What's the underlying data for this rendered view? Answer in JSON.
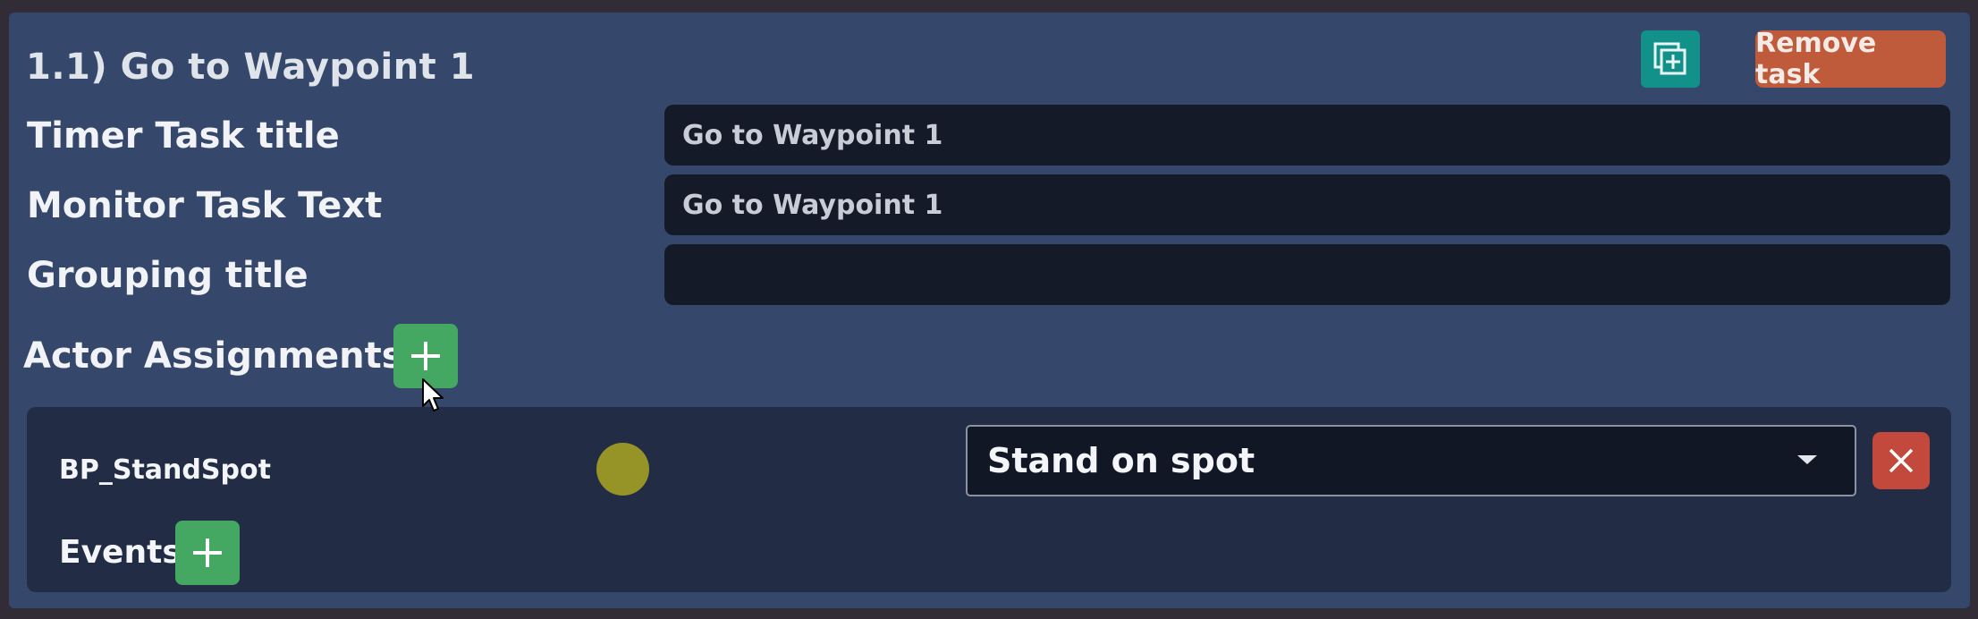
{
  "task": {
    "heading": "1.1) Go to Waypoint 1",
    "duplicate_icon": "duplicate-add-icon",
    "remove_label": "Remove task"
  },
  "fields": {
    "timer_title": {
      "label": "Timer Task title",
      "value": "Go to Waypoint 1"
    },
    "monitor_text": {
      "label": "Monitor Task Text",
      "value": "Go to Waypoint 1"
    },
    "grouping_title": {
      "label": "Grouping title",
      "value": ""
    }
  },
  "actor_assignments": {
    "label": "Actor Assignments",
    "add_icon": "plus-icon",
    "items": [
      {
        "actor": "BP_StandSpot",
        "status_color": "#969427",
        "action": "Stand on spot",
        "delete_icon": "close-icon",
        "events_label": "Events"
      }
    ]
  },
  "colors": {
    "panel": "#35476a",
    "card": "#222d45",
    "input": "#141a28",
    "add_green": "#44a862",
    "remove_orange": "#bf5a3a",
    "duplicate_teal": "#11918a",
    "delete_red": "#c2493c"
  }
}
